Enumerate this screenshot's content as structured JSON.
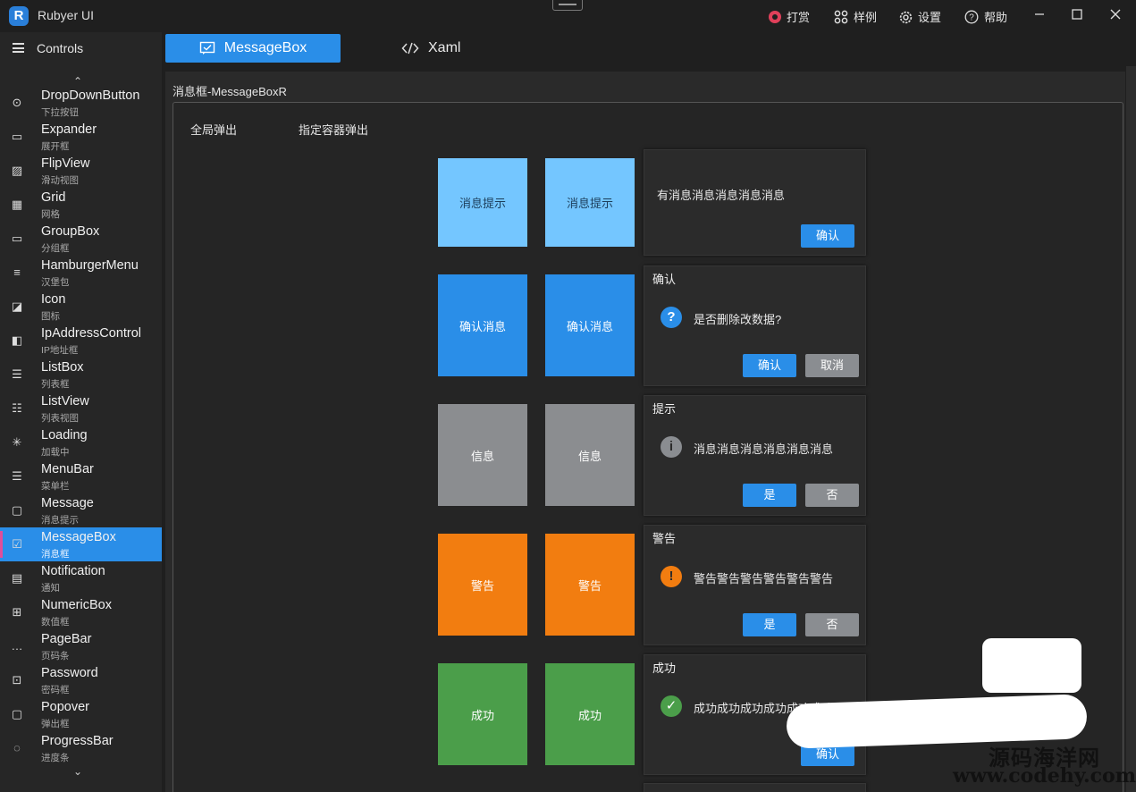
{
  "titlebar": {
    "app_title": "Rubyer UI",
    "logo_letter": "R",
    "actions": [
      {
        "label": "打赏",
        "icon": "reward-icon"
      },
      {
        "label": "样例",
        "icon": "grid-icon"
      },
      {
        "label": "设置",
        "icon": "gear-icon"
      },
      {
        "label": "帮助",
        "icon": "help-icon"
      }
    ],
    "window_buttons": [
      "minimize",
      "maximize",
      "close"
    ]
  },
  "sidebar": {
    "title": "Controls",
    "items": [
      {
        "name": "DropDownButton",
        "sub": "下拉按钮",
        "icon": "dropdown-icon"
      },
      {
        "name": "Expander",
        "sub": "展开框",
        "icon": "expander-icon"
      },
      {
        "name": "FlipView",
        "sub": "滑动视图",
        "icon": "image-icon"
      },
      {
        "name": "Grid",
        "sub": "网格",
        "icon": "grid-icon"
      },
      {
        "name": "GroupBox",
        "sub": "分组框",
        "icon": "groupbox-icon"
      },
      {
        "name": "HamburgerMenu",
        "sub": "汉堡包",
        "icon": "menu-icon"
      },
      {
        "name": "Icon",
        "sub": "图标",
        "icon": "icon-icon"
      },
      {
        "name": "IpAddressControl",
        "sub": "IP地址框",
        "icon": "ip-icon"
      },
      {
        "name": "ListBox",
        "sub": "列表框",
        "icon": "list-icon"
      },
      {
        "name": "ListView",
        "sub": "列表视图",
        "icon": "listview-icon"
      },
      {
        "name": "Loading",
        "sub": "加载中",
        "icon": "loading-icon"
      },
      {
        "name": "MenuBar",
        "sub": "菜单栏",
        "icon": "menubar-icon"
      },
      {
        "name": "Message",
        "sub": "消息提示",
        "icon": "message-icon"
      },
      {
        "name": "MessageBox",
        "sub": "消息框",
        "icon": "messagebox-icon",
        "active": true
      },
      {
        "name": "Notification",
        "sub": "通知",
        "icon": "notification-icon"
      },
      {
        "name": "NumericBox",
        "sub": "数值框",
        "icon": "plus-box-icon"
      },
      {
        "name": "PageBar",
        "sub": "页码条",
        "icon": "ellipsis-icon"
      },
      {
        "name": "Password",
        "sub": "密码框",
        "icon": "lock-icon"
      },
      {
        "name": "Popover",
        "sub": "弹出框",
        "icon": "popover-icon"
      },
      {
        "name": "ProgressBar",
        "sub": "进度条",
        "icon": "progress-icon"
      }
    ]
  },
  "tabs": [
    {
      "label": "MessageBox",
      "icon": "messagebox-icon",
      "active": true
    },
    {
      "label": "Xaml",
      "icon": "code-icon",
      "active": false
    }
  ],
  "page": {
    "caption": "消息框-MessageBoxR",
    "panel_tabs": [
      "全局弹出",
      "指定容器弹出"
    ]
  },
  "rows": [
    {
      "tile_label": "消息提示",
      "color": "#74c6ff",
      "box": {
        "title": "",
        "message": "有消息消息消息消息消息",
        "icon": "",
        "buttons": [
          "确认"
        ]
      }
    },
    {
      "tile_label": "确认消息",
      "color": "#2a8ee8",
      "box": {
        "title": "确认",
        "message": "是否删除改数据?",
        "icon": "question-icon",
        "buttons": [
          "确认",
          "取消"
        ]
      }
    },
    {
      "tile_label": "信息",
      "color": "#8b8d90",
      "box": {
        "title": "提示",
        "message": "消息消息消息消息消息消息",
        "icon": "info-icon",
        "buttons": [
          "是",
          "否"
        ]
      }
    },
    {
      "tile_label": "警告",
      "color": "#f27d10",
      "box": {
        "title": "警告",
        "message": "警告警告警告警告警告警告",
        "icon": "warning-icon",
        "buttons": [
          "是",
          "否"
        ]
      }
    },
    {
      "tile_label": "成功",
      "color": "#4b9e4a",
      "box": {
        "title": "成功",
        "message": "成功成功成功成功成功成功",
        "icon": "success-icon",
        "buttons": [
          "确认"
        ]
      }
    }
  ],
  "watermark": {
    "line1": "源码海洋网",
    "line2": "www.codehy.com"
  }
}
